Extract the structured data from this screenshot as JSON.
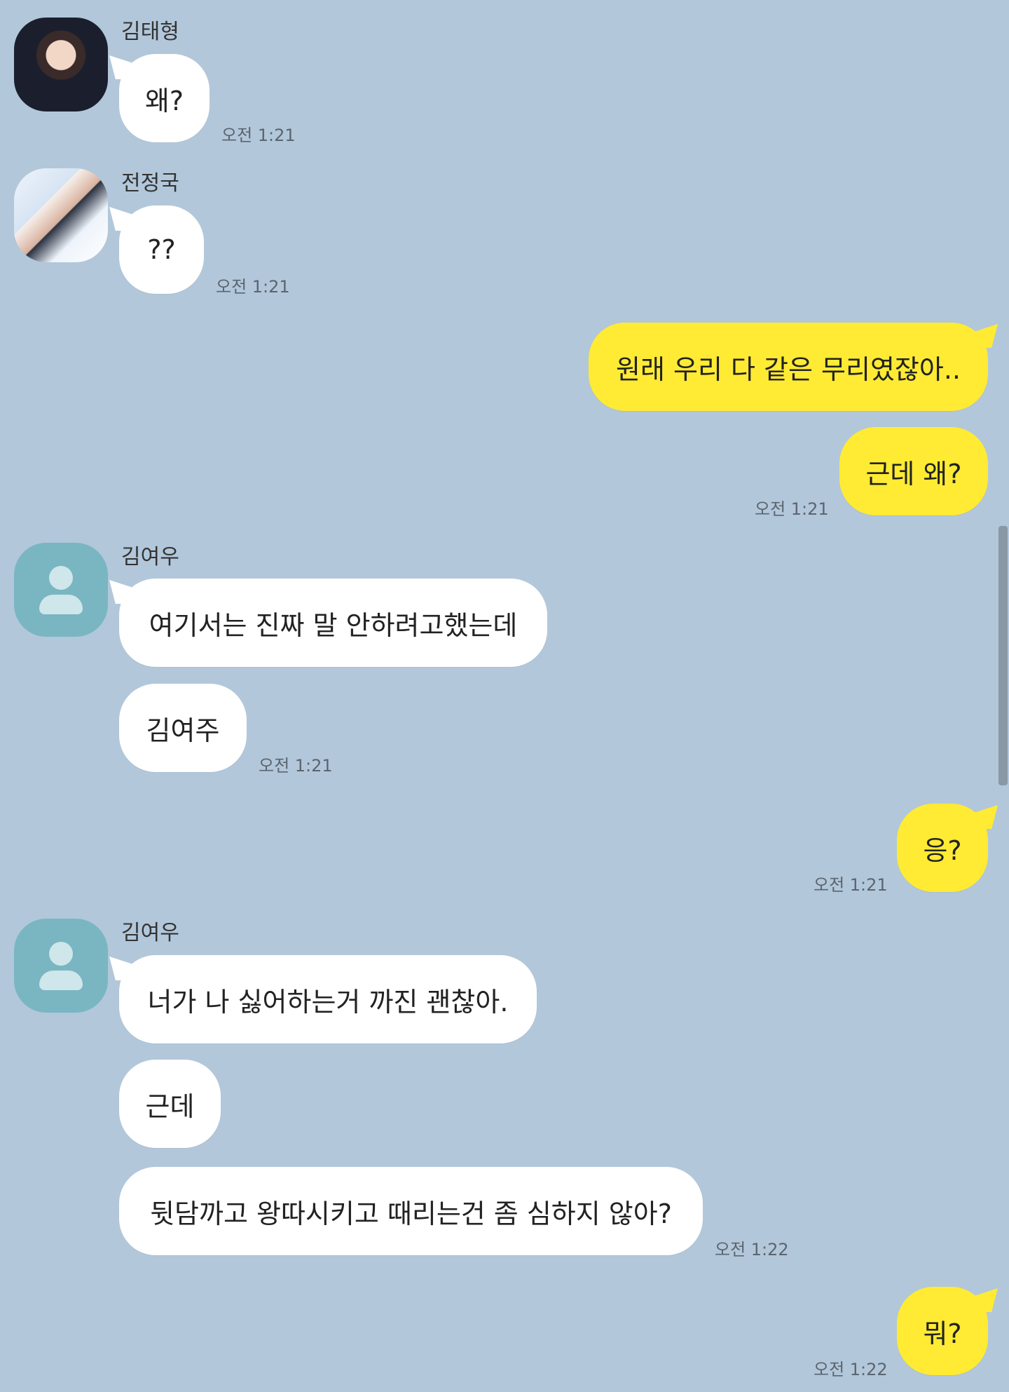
{
  "chat": {
    "messages": {
      "m1": {
        "sender": "김태형",
        "text": "왜?",
        "time": "오전 1:21"
      },
      "m2": {
        "sender": "전정국",
        "text": "??",
        "time": "오전 1:21"
      },
      "m3": {
        "text": "원래 우리 다 같은 무리였잖아.."
      },
      "m4": {
        "text": "근데 왜?",
        "time": "오전 1:21"
      },
      "m5": {
        "sender": "김여우",
        "text": "여기서는 진짜 말 안하려고했는데"
      },
      "m6": {
        "text": "김여주",
        "time": "오전 1:21"
      },
      "m7": {
        "text": "응?",
        "time": "오전 1:21"
      },
      "m8": {
        "sender": "김여우",
        "text": "너가 나 싫어하는거 까진 괜찮아."
      },
      "m9": {
        "text": "근데"
      },
      "m10": {
        "text": "뒷담까고 왕따시키고 때리는건 좀 심하지 않아?",
        "time": "오전 1:22"
      },
      "m11": {
        "text": "뭐?",
        "time": "오전 1:22"
      }
    }
  },
  "colors": {
    "background": "#b2c7da",
    "incoming_bubble": "#ffffff",
    "outgoing_bubble": "#ffeb33",
    "default_avatar": "#79b6c2"
  },
  "icons": {
    "default_profile": "person-icon"
  }
}
